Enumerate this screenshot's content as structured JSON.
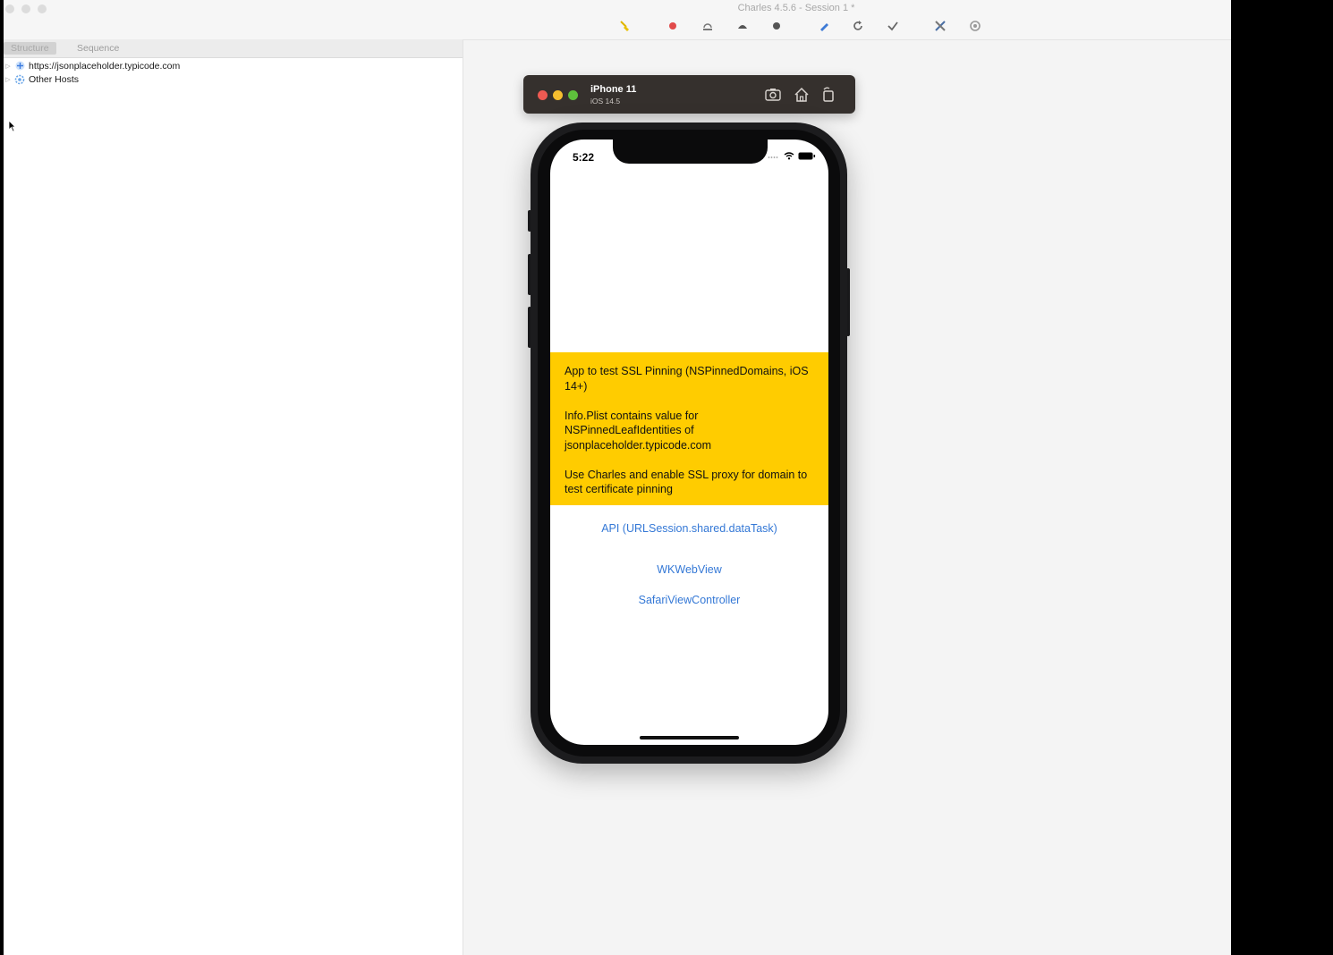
{
  "window": {
    "title": "Charles 4.5.6 - Session 1 *"
  },
  "toolbar": {
    "icons": [
      "broom-icon",
      "record-icon",
      "throttle-icon",
      "turtle-icon",
      "breakpoint-icon",
      "compose-icon",
      "repeat-icon",
      "validate-icon",
      "tools-icon",
      "settings-icon"
    ]
  },
  "left_panel": {
    "tabs": [
      "Structure",
      "Sequence"
    ],
    "tree": [
      {
        "label": "https://jsonplaceholder.typicode.com",
        "icon": "lock-globe-icon"
      },
      {
        "label": "Other Hosts",
        "icon": "gear-host-icon"
      }
    ]
  },
  "simulator": {
    "device": "iPhone 11",
    "os": "iOS 14.5",
    "buttons": [
      "screenshot-icon",
      "home-icon",
      "rotate-icon"
    ]
  },
  "phone": {
    "status_time": "5:22",
    "yellow_color": "#ffcc00",
    "info_lines": [
      "App to test SSL Pinning (NSPinnedDomains, iOS 14+)",
      "Info.Plist contains value for NSPinnedLeafIdentities of jsonplaceholder.typicode.com",
      "Use Charles and enable SSL proxy for domain to test certificate pinning"
    ],
    "links": [
      "API (URLSession.shared.dataTask)",
      "WKWebView",
      "SafariViewController"
    ],
    "link_color": "#3478d6"
  }
}
